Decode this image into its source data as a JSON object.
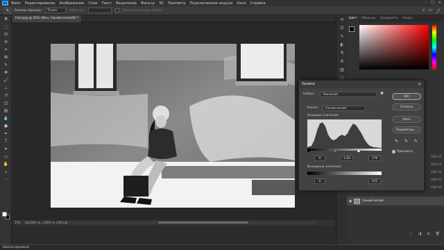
{
  "menu": {
    "logo": "Ps",
    "items": [
      "Файл",
      "Редактирование",
      "Изображение",
      "Слои",
      "Текст",
      "Выделение",
      "Фильтр",
      "3D",
      "Просмотр",
      "Подключаемые модули",
      "Окно",
      "Справка"
    ]
  },
  "options_bar": {
    "sample_size_label": "Размер образца:",
    "sample_size_value": "Точка",
    "sample_label": "Образец:",
    "sample_value": "",
    "show_ring_label": "Показать кольцо пробы"
  },
  "document_tab": {
    "title": "Foto.jpg @ 25% (Фон, Синий копия/8) *"
  },
  "status_bar": {
    "zoom": "25%",
    "info": "2&1600 пк x 2400 пк (300 ppi)"
  },
  "timeline_label": "Шкала времени",
  "right_panel": {
    "tabs": [
      "Цвет",
      "Образцы",
      "Градиенты",
      "Узоры"
    ],
    "active_tab": "Цвет",
    "channel_shortcuts": [
      "Ctrl+2",
      "Ctrl+3",
      "Ctrl+4",
      "Ctrl+5",
      "Ctrl+6"
    ],
    "layer_name": "Синий копия"
  },
  "levels_dialog": {
    "title": "Уровни",
    "preset_label": "Набор:",
    "preset_value": "Заказная",
    "channel_label": "Канал:",
    "channel_value": "Синий копия",
    "input_label": "Входные значения:",
    "input_black": "0",
    "input_gamma": "1,00",
    "input_white": "176",
    "output_label": "Выходные значения:",
    "output_black": "0",
    "output_white": "255",
    "ok": "ОК",
    "cancel": "Отмена",
    "auto": "Авто",
    "options": "Параметры...",
    "preview": "Просмотр"
  }
}
